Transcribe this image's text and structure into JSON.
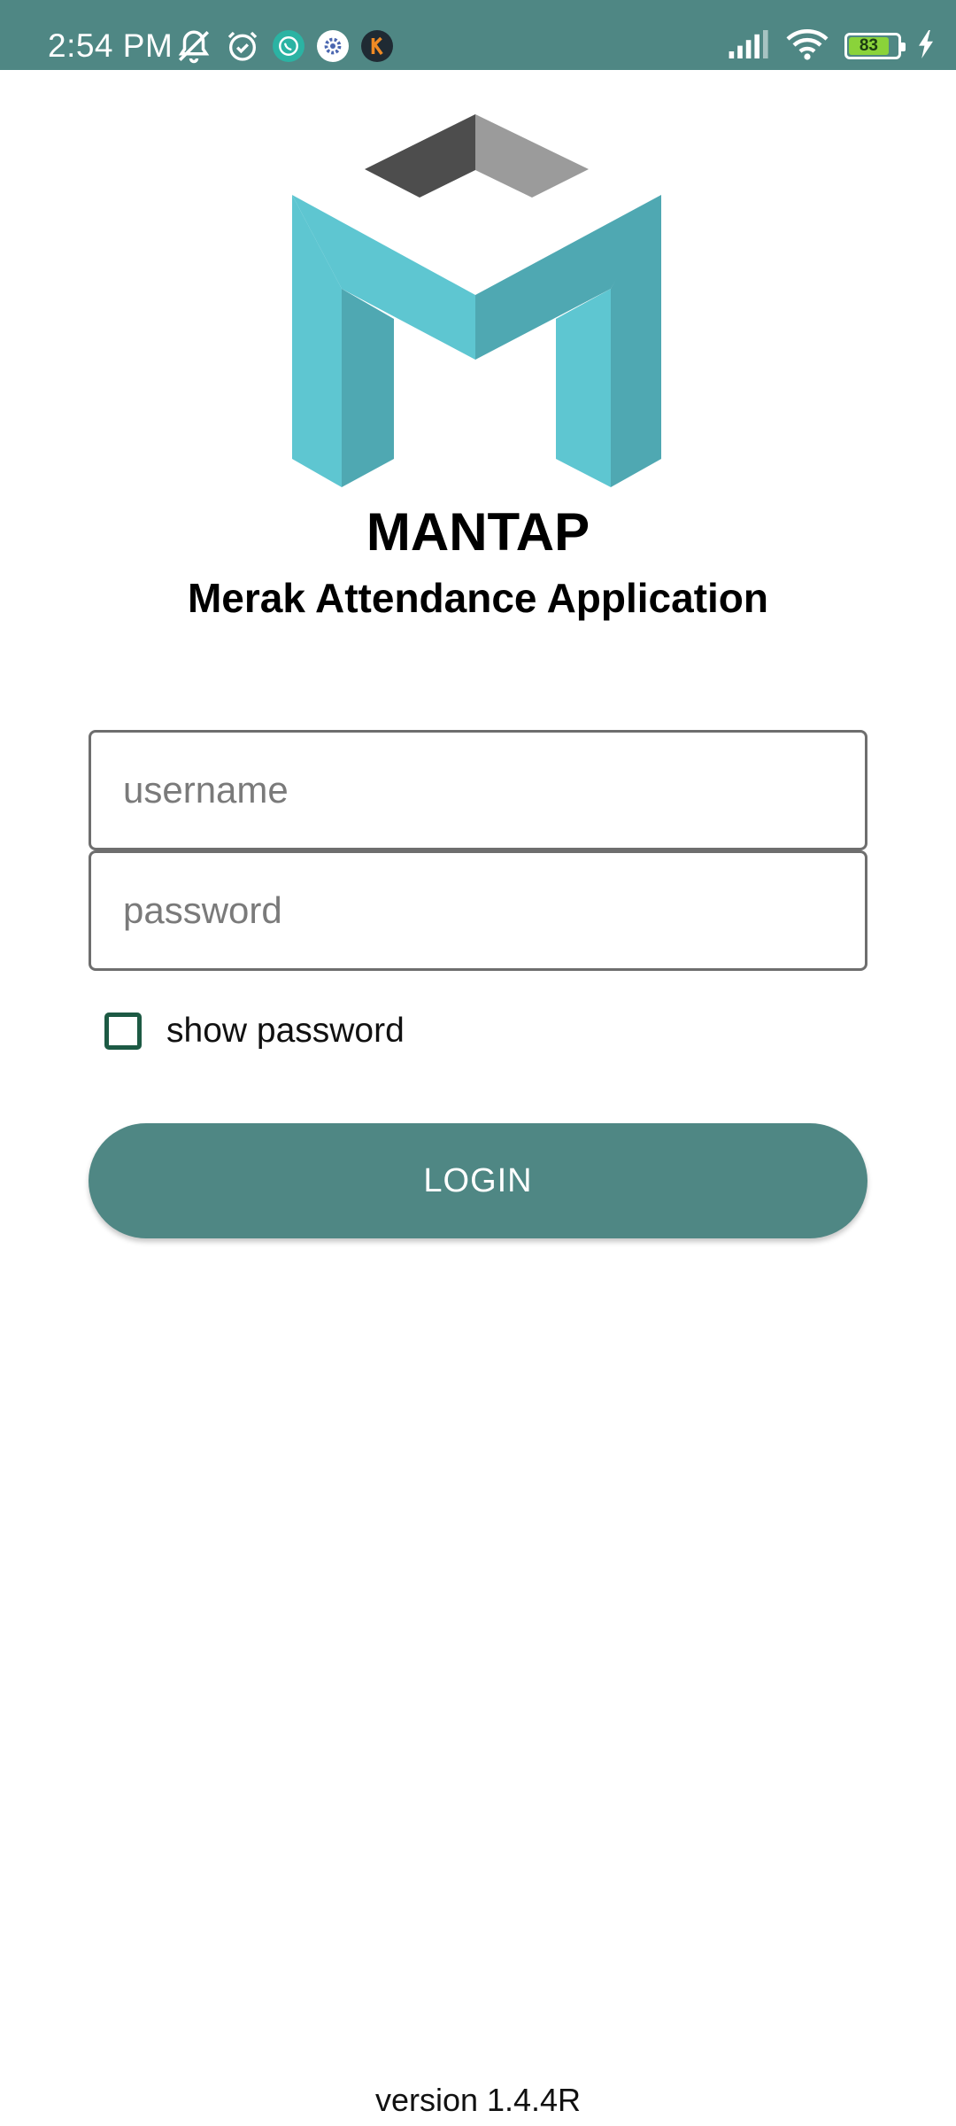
{
  "status_bar": {
    "time": "2:54 PM",
    "battery_level": "83",
    "background_color": "#4f8784",
    "left_icons": [
      "muted-bell-icon",
      "alarm-icon",
      "whatsapp-icon",
      "app-gear-icon",
      "k-app-icon"
    ],
    "right_icons": [
      "signal-icon",
      "wifi-icon",
      "battery-icon",
      "charging-icon"
    ]
  },
  "brand": {
    "title": "MANTAP",
    "subtitle": "Merak Attendance Application",
    "logo_colors": {
      "teal_light": "#5ec6d1",
      "teal_dark": "#4fa8b2",
      "grey_dark": "#4d4d4d",
      "grey_light": "#9b9b9b"
    }
  },
  "form": {
    "username_placeholder": "username",
    "username_value": "",
    "password_placeholder": "password",
    "password_value": "",
    "show_password_label": "show password",
    "show_password_checked": false
  },
  "actions": {
    "login_label": "LOGIN",
    "accent_color": "#4f8784"
  },
  "footer": {
    "version": "version 1.4.4R"
  }
}
